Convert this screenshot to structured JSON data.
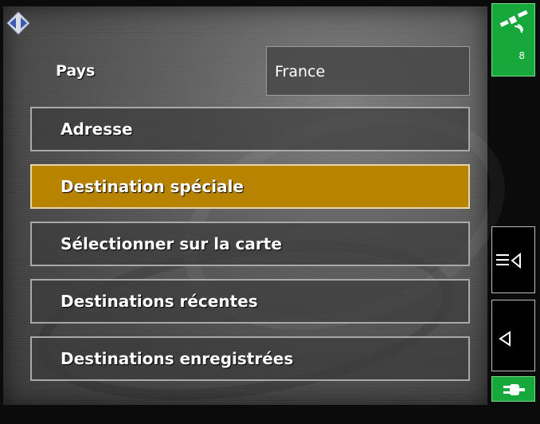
{
  "header": {
    "back_icon": "diamond-arrows-icon"
  },
  "country": {
    "label": "Pays",
    "value": "France"
  },
  "menu": {
    "items": [
      {
        "label": "Adresse"
      },
      {
        "label": "Destination spéciale",
        "selected": true
      },
      {
        "label": "Sélectionner sur la carte"
      },
      {
        "label": "Destinations récentes"
      },
      {
        "label": "Destinations enregistrées"
      }
    ]
  },
  "sidebar": {
    "gps": {
      "icon": "satellite-icon",
      "satellites": "8",
      "color": "#16a83a"
    },
    "menu_button_icon": "list-menu-icon",
    "back_button_icon": "back-triangle-icon",
    "power": {
      "icon": "power-plug-icon",
      "color": "#16a83a"
    }
  },
  "colors": {
    "selected": "#b88400",
    "item_border": "#a9a9a9"
  }
}
